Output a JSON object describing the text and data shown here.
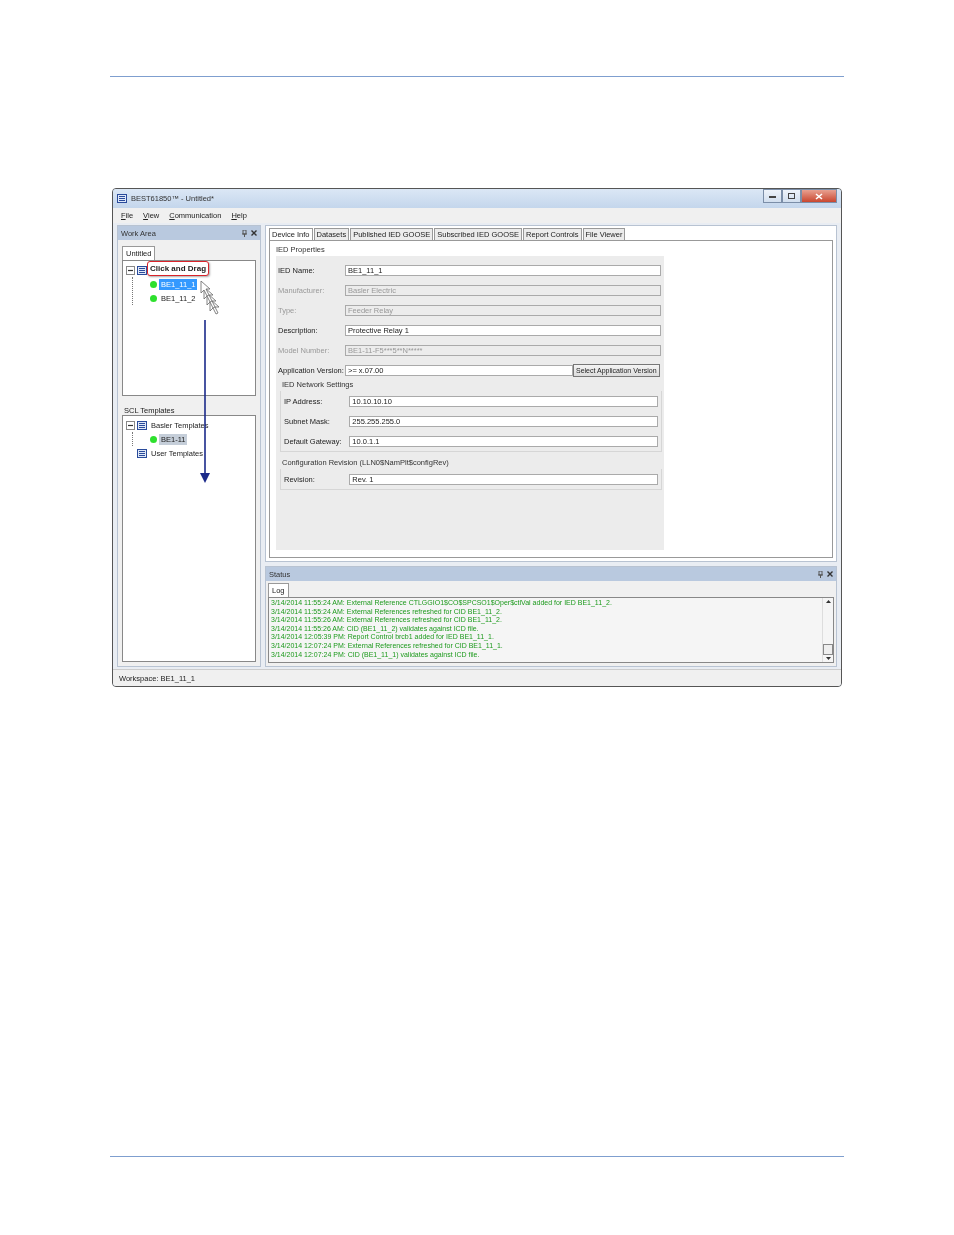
{
  "window": {
    "title": "BEST61850™ - Untitled*"
  },
  "menu": [
    {
      "label": "File"
    },
    {
      "label": "View"
    },
    {
      "label": "Communication"
    },
    {
      "label": "Help"
    }
  ],
  "work_area": {
    "title": "Work Area",
    "tab": "Untitled",
    "focused": true,
    "tree": [
      {
        "kind": "group",
        "expanded": true,
        "children": [
          {
            "kind": "device",
            "label": "BE1_11_1",
            "selected": true
          },
          {
            "kind": "device",
            "label": "BE1_11_2",
            "selected": false
          }
        ]
      }
    ]
  },
  "callout": {
    "text": "Click and Drag"
  },
  "scl_templates": {
    "title": "SCL Templates",
    "focused": false,
    "tree": [
      {
        "kind": "group",
        "label": "Basler Templates",
        "expanded": true,
        "selected": false,
        "children": [
          {
            "kind": "device",
            "label": "BE1-11",
            "selected": true
          }
        ]
      },
      {
        "kind": "group",
        "label": "User Templates",
        "selected": false
      }
    ]
  },
  "tabs": [
    {
      "label": "Device Info",
      "selected": true
    },
    {
      "label": "Datasets",
      "selected": false
    },
    {
      "label": "Published IED GOOSE",
      "selected": false
    },
    {
      "label": "Subscribed IED GOOSE",
      "selected": false
    },
    {
      "label": "Report Controls",
      "selected": false
    },
    {
      "label": "File Viewer",
      "selected": false
    }
  ],
  "ied_properties": {
    "title": "IED Properties",
    "fields": [
      {
        "label": "IED Name:",
        "value": "BE1_11_1",
        "disabled": false
      },
      {
        "label": "Manufacturer:",
        "value": "Basler Electric",
        "disabled": true
      },
      {
        "label": "Type:",
        "value": "Feeder Relay",
        "disabled": true
      },
      {
        "label": "Description:",
        "value": "Protective Relay 1",
        "disabled": false
      },
      {
        "label": "Model Number:",
        "value": "BE1-11-F5***5**N*****",
        "disabled": true
      },
      {
        "label": "Application Version:",
        "value": ">= x.07.00",
        "disabled": false,
        "button": "Select Application Version"
      }
    ]
  },
  "network": {
    "title": "IED Network Settings",
    "fields": [
      {
        "label": "IP Address:",
        "value": "10.10.10.10",
        "disabled": false
      },
      {
        "label": "Subnet Mask:",
        "value": "255.255.255.0",
        "disabled": false
      },
      {
        "label": "Default Gateway:",
        "value": "10.0.1.1",
        "disabled": false
      }
    ]
  },
  "config_revision": {
    "title": "Configuration Revision (LLN0$NamPlt$configRev)",
    "fields": [
      {
        "label": "Revision:",
        "value": "Rev. 1",
        "disabled": false
      }
    ]
  },
  "status": {
    "title": "Status",
    "tab": "Log",
    "log": [
      "3/14/2014 11:55:24 AM: External Reference CTLGGIO1$CO$SPCSO1$Oper$ctlVal added for IED BE1_11_2.",
      "3/14/2014 11:55:24 AM: External References refreshed for CID BE1_11_2.",
      "3/14/2014 11:55:26 AM: External References refreshed for CID BE1_11_2.",
      "3/14/2014 11:55:26 AM: CID (BE1_11_2) validates against ICD file.",
      "3/14/2014 12:05:39 PM: Report Control brcb1 added for IED BE1_11_1.",
      "3/14/2014 12:07:24 PM: External References refreshed for CID BE1_11_1.",
      "3/14/2014 12:07:24 PM: CID (BE1_11_1) validates against ICD file."
    ]
  },
  "status_bar": {
    "text": "Workspace: BE1_11_1"
  }
}
